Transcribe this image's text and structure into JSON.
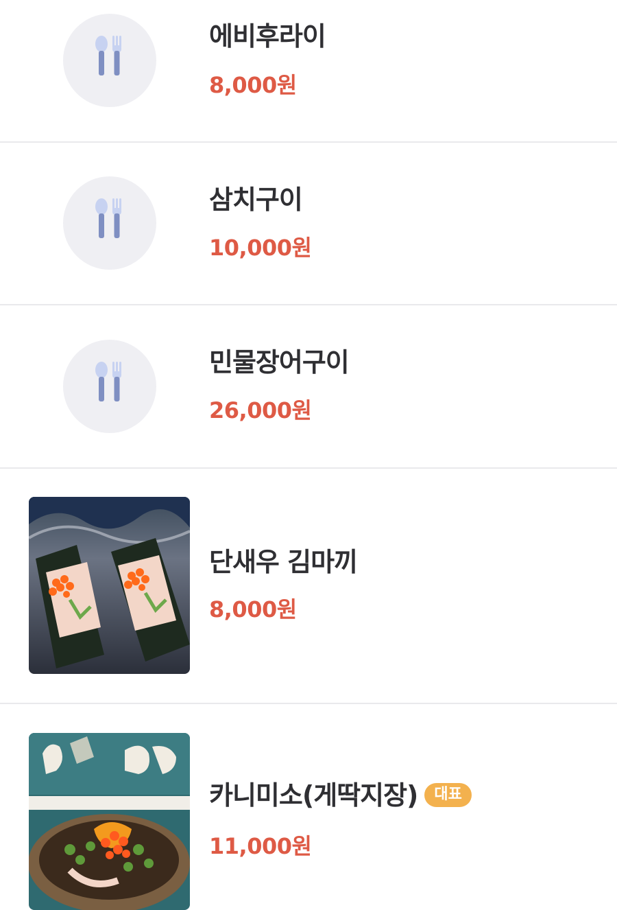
{
  "menu": {
    "items": [
      {
        "name": "에비후라이",
        "price": "8,000원",
        "thumbnail": "utensils-placeholder"
      },
      {
        "name": "삼치구이",
        "price": "10,000원",
        "thumbnail": "utensils-placeholder"
      },
      {
        "name": "민물장어구이",
        "price": "26,000원",
        "thumbnail": "utensils-placeholder"
      },
      {
        "name": "단새우 김마끼",
        "price": "8,000원",
        "thumbnail": "photo"
      },
      {
        "name": "카니미소(게딱지장)",
        "price": "11,000원",
        "thumbnail": "photo",
        "badge": "대표"
      }
    ]
  },
  "colors": {
    "price": "#de5a45",
    "badge": "#f3b14e",
    "placeholder_bg": "#efeff3",
    "icon": "#7f8fc2"
  }
}
